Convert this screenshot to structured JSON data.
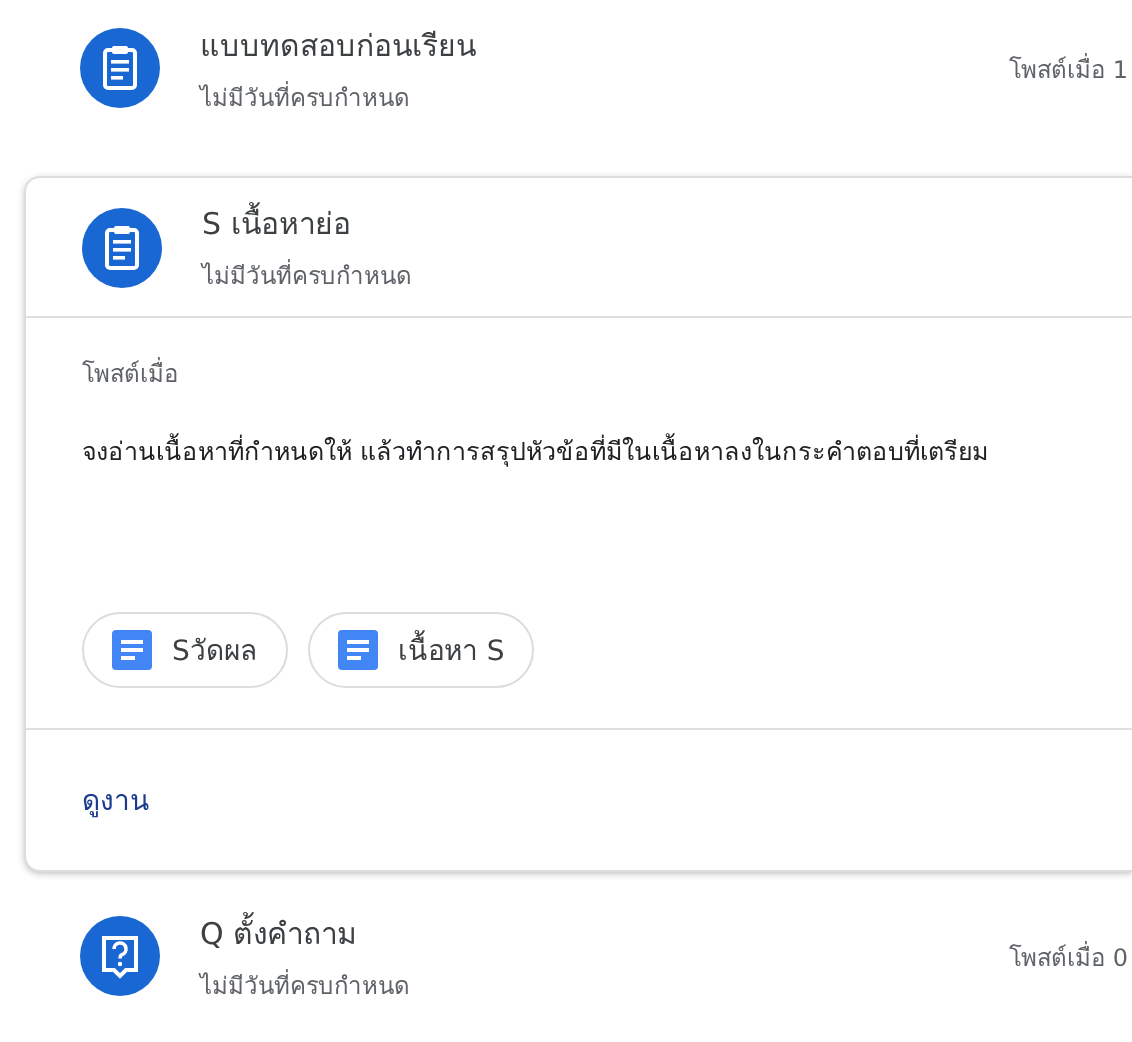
{
  "items": [
    {
      "kind": "assignment",
      "title": "แบบทดสอบก่อนเรียน",
      "due": "ไม่มีวันที่ครบกำหนด",
      "posted": "โพสต์เมื่อ 1",
      "expanded": false
    },
    {
      "kind": "assignment",
      "title": "S เนื้อหาย่อ",
      "due": "ไม่มีวันที่ครบกำหนด",
      "expanded": true,
      "posted_label": "โพสต์เมื่อ",
      "description": "จงอ่านเนื้อหาที่กำหนดให้ แล้วทำการสรุปหัวข้อที่มีในเนื้อหาลงในกระคำตอบที่เตรียม",
      "attachments": [
        "Sวัดผล",
        "เนื้อหา S"
      ],
      "action": "ดูงาน"
    },
    {
      "kind": "question",
      "title": "Q ตั้งคำถาม",
      "due": "ไม่มีวันที่ครบกำหนด",
      "posted": "โพสต์เมื่อ 0",
      "expanded": false
    }
  ]
}
